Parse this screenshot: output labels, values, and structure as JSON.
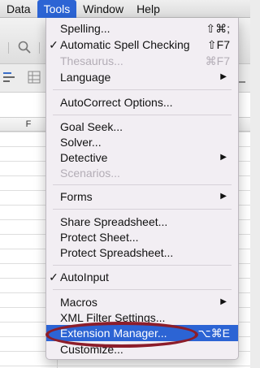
{
  "menubar": {
    "items": [
      "Data",
      "Tools",
      "Window",
      "Help"
    ]
  },
  "sheet": {
    "column_label": "F"
  },
  "tools_menu": {
    "items": [
      {
        "label": "Spelling...",
        "shortcut": "⇧⌘;",
        "checked": false,
        "disabled": false,
        "submenu": false
      },
      {
        "label": "Automatic Spell Checking",
        "shortcut": "⇧F7",
        "checked": true,
        "disabled": false,
        "submenu": false
      },
      {
        "label": "Thesaurus...",
        "shortcut": "⌘F7",
        "checked": false,
        "disabled": true,
        "submenu": false
      },
      {
        "label": "Language",
        "shortcut": "",
        "checked": false,
        "disabled": false,
        "submenu": true
      },
      {
        "label": "AutoCorrect Options...",
        "shortcut": "",
        "checked": false,
        "disabled": false,
        "submenu": false
      },
      {
        "label": "Goal Seek...",
        "shortcut": "",
        "checked": false,
        "disabled": false,
        "submenu": false
      },
      {
        "label": "Solver...",
        "shortcut": "",
        "checked": false,
        "disabled": false,
        "submenu": false
      },
      {
        "label": "Detective",
        "shortcut": "",
        "checked": false,
        "disabled": false,
        "submenu": true
      },
      {
        "label": "Scenarios...",
        "shortcut": "",
        "checked": false,
        "disabled": true,
        "submenu": false
      },
      {
        "label": "Forms",
        "shortcut": "",
        "checked": false,
        "disabled": false,
        "submenu": true
      },
      {
        "label": "Share Spreadsheet...",
        "shortcut": "",
        "checked": false,
        "disabled": false,
        "submenu": false
      },
      {
        "label": "Protect Sheet...",
        "shortcut": "",
        "checked": false,
        "disabled": false,
        "submenu": false
      },
      {
        "label": "Protect Spreadsheet...",
        "shortcut": "",
        "checked": false,
        "disabled": false,
        "submenu": false
      },
      {
        "label": "AutoInput",
        "shortcut": "",
        "checked": true,
        "disabled": false,
        "submenu": false
      },
      {
        "label": "Macros",
        "shortcut": "",
        "checked": false,
        "disabled": false,
        "submenu": true
      },
      {
        "label": "XML Filter Settings...",
        "shortcut": "",
        "checked": false,
        "disabled": false,
        "submenu": false
      },
      {
        "label": "Extension Manager...",
        "shortcut": "⌥⌘E",
        "checked": false,
        "disabled": false,
        "submenu": false,
        "highlighted": true
      },
      {
        "label": "Customize...",
        "shortcut": "",
        "checked": false,
        "disabled": false,
        "submenu": false
      }
    ]
  },
  "glyphs": {
    "check": "✓",
    "submenu_arrow": "▶"
  },
  "colors": {
    "highlight": "#2c64d4",
    "annotation_circle": "#8c1d2a"
  }
}
